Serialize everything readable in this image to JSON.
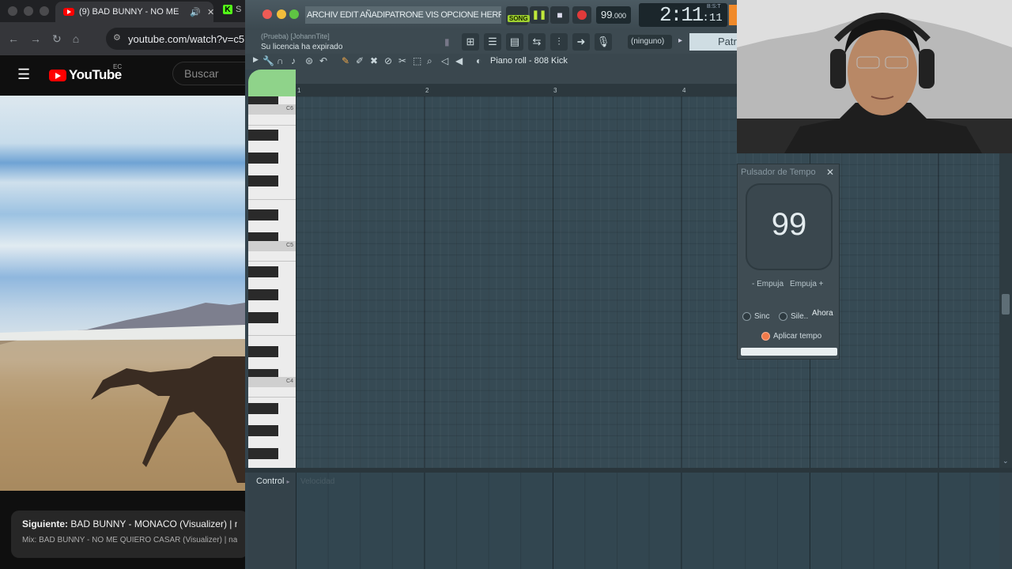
{
  "browser": {
    "tab_title": "(9) BAD BUNNY - NO ME",
    "tab2_label": "S",
    "url": "youtube.com/watch?v=c5",
    "yt_logo": "YouTube",
    "yt_region": "EC",
    "search_placeholder": "Buscar",
    "next_prefix": "Siguiente:",
    "next_title": "BAD BUNNY - MONACO (Visualizer) | nadie",
    "mix_title": "Mix: BAD BUNNY - NO ME QUIERO CASAR (Visualizer) | nadie s"
  },
  "fl": {
    "menu": "ARCHIV EDIT AÑADIPATRONE VIS OPCIONE HERRAMIENTAY",
    "song_badge": "SONG",
    "tempo": "99",
    "tempo_frac": ".000",
    "time_main": "2:11",
    "time_sub": ":11",
    "time_unit": "B:S:T",
    "hint": "(Prueba) [JohannTite]",
    "hint_msg": "Su licencia ha expirado",
    "output": "(ninguno)",
    "pattern": "Patro",
    "piano_roll_title": "Piano roll - 808 Kick",
    "bars": [
      "1",
      "2",
      "3",
      "4"
    ],
    "octaves": [
      "C6",
      "C5",
      "C4"
    ],
    "control_label": "Control",
    "control_sub": "Velocidad"
  },
  "tapper": {
    "title": "Pulsador de Tempo",
    "value": "99",
    "nudge_minus": "- Empuja",
    "nudge_plus": "Empuja +",
    "sync": "Sinc",
    "silent": "Sile..",
    "now": "Ahora",
    "apply": "Aplicar tempo"
  },
  "colors": {
    "fl_bg": "#34444d",
    "accent_green": "#9fd12f",
    "record_red": "#e03a3a",
    "yt_red": "#ff0000"
  }
}
